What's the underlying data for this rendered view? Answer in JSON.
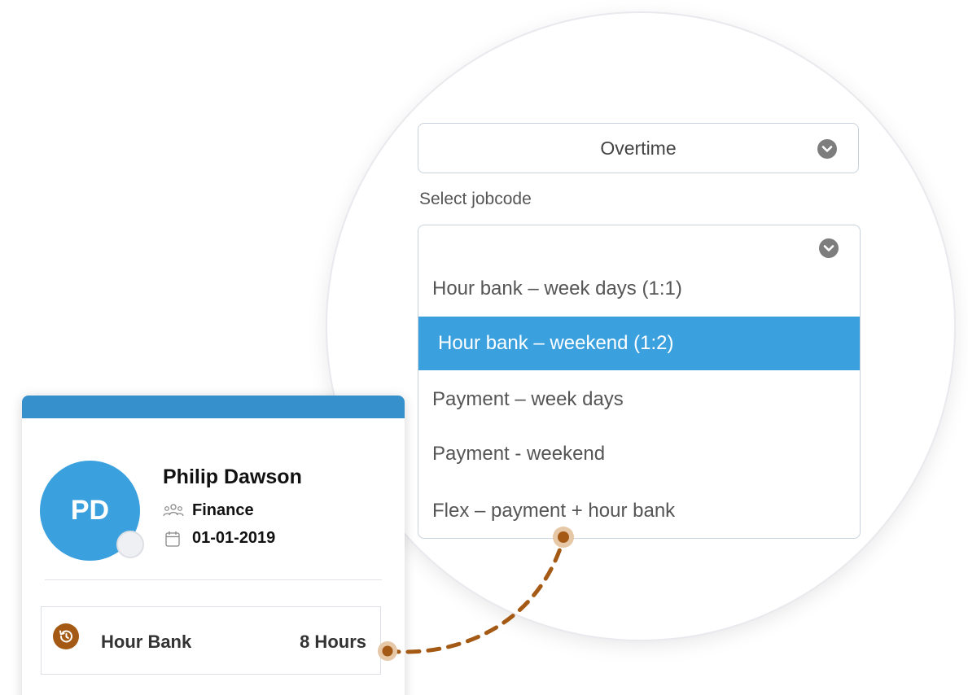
{
  "overtime_select": {
    "value": "Overtime",
    "icon": "chevron-down-icon"
  },
  "jobcode": {
    "label": "Select jobcode",
    "options": [
      {
        "label": "Hour bank – week days (1:1)",
        "selected": false
      },
      {
        "label": "Hour bank – weekend (1:2)",
        "selected": true
      },
      {
        "label": "Payment – week days",
        "selected": false
      },
      {
        "label": "Payment - weekend",
        "selected": false
      },
      {
        "label": "Flex – payment + hour bank",
        "selected": false
      }
    ]
  },
  "profile": {
    "initials": "PD",
    "name": "Philip Dawson",
    "department": "Finance",
    "date": "01-01-2019"
  },
  "hour_bank": {
    "label": "Hour Bank",
    "value": "8 Hours",
    "icon": "history-icon"
  },
  "colors": {
    "accent": "#3aa0de",
    "header": "#3590cc",
    "selected_option": "#3aa0de",
    "connector": "#a45a14"
  }
}
